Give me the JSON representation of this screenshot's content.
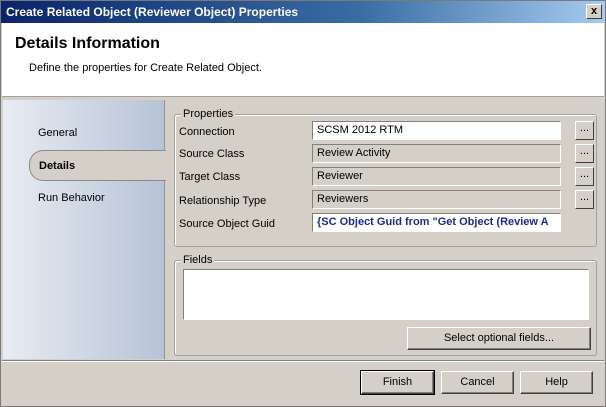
{
  "window": {
    "title": "Create Related Object (Reviewer Object) Properties",
    "close_label": "x"
  },
  "header": {
    "title": "Details Information",
    "subtitle": "Define the properties for Create Related Object."
  },
  "nav": {
    "items": [
      {
        "label": "General"
      },
      {
        "label": "Details",
        "selected": true
      },
      {
        "label": "Run Behavior"
      }
    ]
  },
  "properties": {
    "group_title": "Properties",
    "connection": {
      "label": "Connection",
      "value": "SCSM 2012 RTM"
    },
    "source_class": {
      "label": "Source Class",
      "value": "Review Activity"
    },
    "target_class": {
      "label": "Target Class",
      "value": "Reviewer"
    },
    "relationship_type": {
      "label": "Relationship Type",
      "value": "Reviewers"
    },
    "source_object_guid": {
      "label": "Source Object Guid",
      "value": "{SC Object Guid from \"Get Object (Review A"
    },
    "browse_label": "..."
  },
  "fields": {
    "group_title": "Fields",
    "select_button": "Select optional fields..."
  },
  "footer": {
    "finish": "Finish",
    "cancel": "Cancel",
    "help": "Help"
  }
}
